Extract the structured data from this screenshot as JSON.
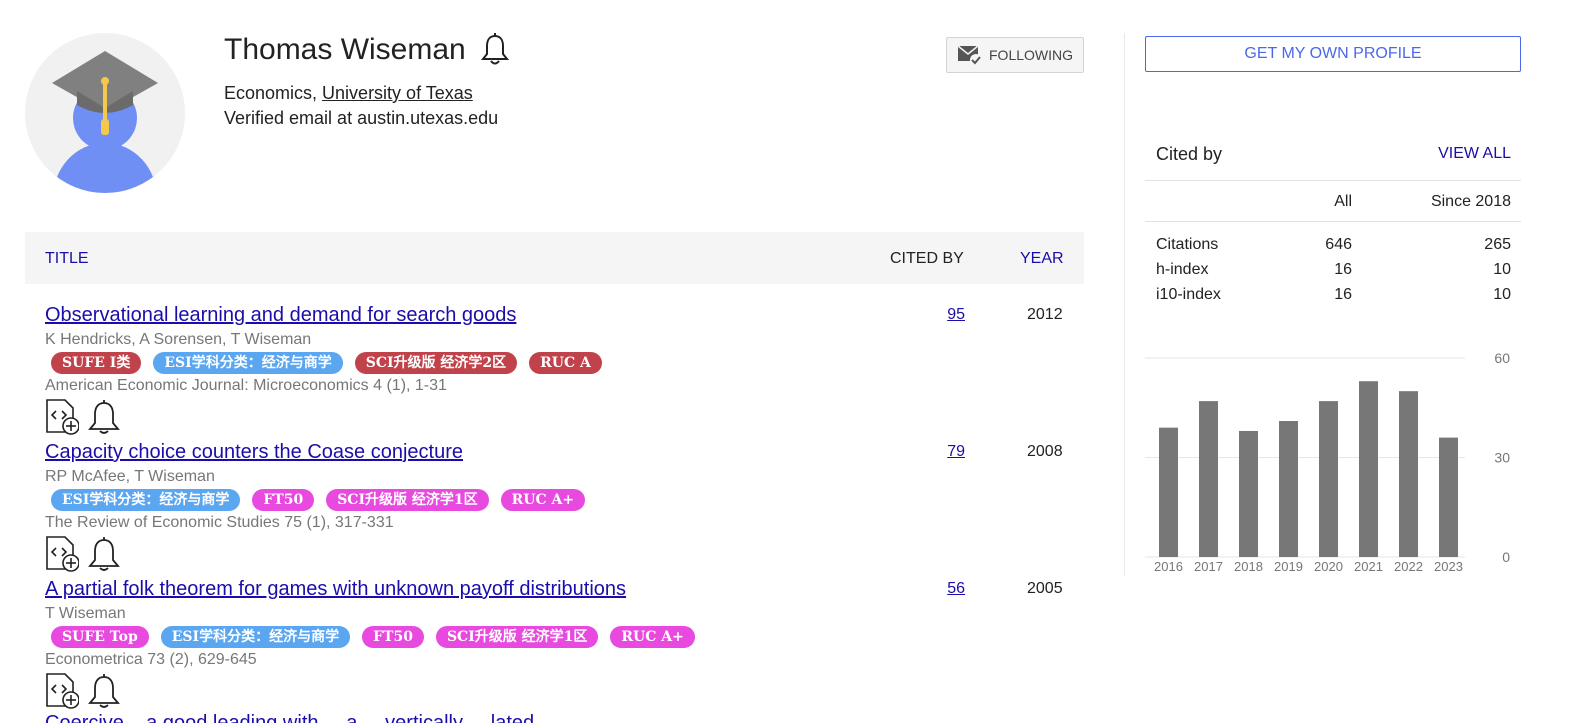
{
  "profile": {
    "name": "Thomas Wiseman",
    "affiliation_prefix": "Economics, ",
    "affiliation_link": "University of Texas",
    "email": "Verified email at austin.utexas.edu",
    "follow_label": "FOLLOWING"
  },
  "table": {
    "header_title": "TITLE",
    "header_cited": "CITED BY",
    "header_year": "YEAR"
  },
  "colors": {
    "link": "#1a0dab",
    "tag_red": "#c0424a",
    "tag_blue": "#5aa6f0",
    "tag_magenta": "#e84ae0",
    "bar": "#777777"
  },
  "articles": [
    {
      "title": "Observational learning and demand for search goods",
      "authors": "K Hendricks, A Sorensen, T Wiseman",
      "tags": [
        {
          "label": "SUFE I类",
          "color": "#c0424a"
        },
        {
          "label": "ESI学科分类：经济与商学",
          "color": "#5aa6f0"
        },
        {
          "label": "SCI升级版 经济学2区",
          "color": "#c0424a"
        },
        {
          "label": "RUC A",
          "color": "#c0424a"
        }
      ],
      "venue": "American Economic Journal: Microeconomics 4 (1), 1-31",
      "cited_by": "95",
      "year": "2012"
    },
    {
      "title": "Capacity choice counters the Coase conjecture",
      "authors": "RP McAfee, T Wiseman",
      "tags": [
        {
          "label": "ESI学科分类：经济与商学",
          "color": "#5aa6f0"
        },
        {
          "label": "FT50",
          "color": "#e84ae0"
        },
        {
          "label": "SCI升级版 经济学1区",
          "color": "#e84ae0"
        },
        {
          "label": "RUC A+",
          "color": "#e84ae0"
        }
      ],
      "venue": "The Review of Economic Studies 75 (1), 317-331",
      "cited_by": "79",
      "year": "2008"
    },
    {
      "title": "A partial folk theorem for games with unknown payoff distributions",
      "authors": "T Wiseman",
      "tags": [
        {
          "label": "SUFE Top",
          "color": "#e84ae0"
        },
        {
          "label": "ESI学科分类：经济与商学",
          "color": "#5aa6f0"
        },
        {
          "label": "FT50",
          "color": "#e84ae0"
        },
        {
          "label": "SCI升级版 经济学1区",
          "color": "#e84ae0"
        },
        {
          "label": "RUC A+",
          "color": "#e84ae0"
        }
      ],
      "venue": "Econometrica 73 (2), 629-645",
      "cited_by": "56",
      "year": "2005"
    }
  ],
  "truncated_next_title": "Coercive... a good leading with ... a ... vertically ... lated",
  "sidebar": {
    "own_profile_label": "GET MY OWN PROFILE",
    "cited_by_title": "Cited by",
    "view_all_label": "VIEW ALL",
    "col_all": "All",
    "col_since": "Since 2018",
    "stats": [
      {
        "label": "Citations",
        "all": "646",
        "since": "265"
      },
      {
        "label": "h-index",
        "all": "16",
        "since": "10"
      },
      {
        "label": "i10-index",
        "all": "16",
        "since": "10"
      }
    ]
  },
  "chart_data": {
    "type": "bar",
    "categories": [
      "2016",
      "2017",
      "2018",
      "2019",
      "2020",
      "2021",
      "2022",
      "2023"
    ],
    "values": [
      39,
      47,
      38,
      41,
      47,
      53,
      50,
      36
    ],
    "ylim": [
      0,
      60
    ],
    "yticks": [
      "0",
      "30",
      "60"
    ],
    "grid": true,
    "title": "",
    "xlabel": "",
    "ylabel": ""
  }
}
